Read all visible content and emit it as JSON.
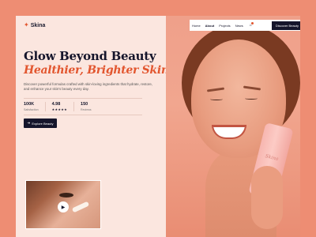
{
  "brand": {
    "logo_mark": "✦",
    "name": "Skina"
  },
  "nav": {
    "items": [
      {
        "label": "Home",
        "active": false
      },
      {
        "label": "About",
        "active": true
      },
      {
        "label": "Projects",
        "active": false
      },
      {
        "label": "News",
        "active": false
      }
    ],
    "cart_icon": "bag-icon",
    "cta_label": "Discover Beauty"
  },
  "hero": {
    "title": "Glow Beyond Beauty",
    "subtitle": "Healthier, Brighter Skin",
    "description": "Discover powerful formulas crafted with skin-loving ingredients that hydrate, restore, and enhance your skin's beauty every day.",
    "stats": [
      {
        "value": "100K",
        "label": "Satisfaction"
      },
      {
        "value": "4.98",
        "label": "★★★★★"
      },
      {
        "value": "150",
        "label": "Reviews"
      }
    ],
    "cta_label": "Explore Beauty"
  },
  "video_thumb": {
    "play_icon": "play-icon"
  },
  "product": {
    "brand_text": "Skina"
  },
  "colors": {
    "accent": "#e2562f",
    "dark": "#15152b",
    "page_bg": "#ee8d73"
  }
}
